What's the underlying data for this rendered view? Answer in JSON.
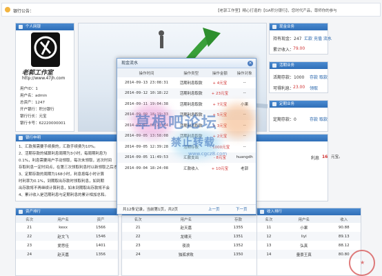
{
  "bank_notice": {
    "label": "银行公告：",
    "text": "【老郭工作室】精心打造的【GA积分银行】，您时代产品，尊师你的参与"
  },
  "personal": {
    "title": "个人网银",
    "logo_text": "老郭工作室",
    "logo_url": "http://www.47jh.com",
    "fields": [
      {
        "label": "用户ID：",
        "value": "1"
      },
      {
        "label": "用户名：",
        "value": "admin"
      },
      {
        "label": "总资产：",
        "value": "1247"
      },
      {
        "label": "开户银行：",
        "value": "积分银行"
      },
      {
        "label": "银行行长：",
        "value": "元宝"
      },
      {
        "label": "银行卡号：",
        "value": "62220000001"
      }
    ]
  },
  "cash": {
    "title": "现金业务",
    "holdings_label": "持有现金：247",
    "actions": [
      "汇款",
      "充值",
      "流水"
    ],
    "total_label": "累计收入：",
    "total_value": "79.00"
  },
  "demand": {
    "title": "活期业务",
    "deposit_label": "活期存款：1000",
    "deposit_actions": [
      "存款",
      "取款"
    ],
    "interest_label": "可得利息：",
    "interest_value": "23.00",
    "interest_action": "领取"
  },
  "fixed": {
    "title": "定期业务",
    "deposit_label": "定期存款：0",
    "deposit_actions": [
      "存款",
      "取款"
    ]
  },
  "rules": {
    "title": "银行申明",
    "lines": [
      "1、汇款虽需要手续费的，汇款手续费为10%。",
      "2、活期存款的储算利息周期为3小时，每周期利息为",
      "0.1%，利息需要用户手动领取，每次未领取，这次时间",
      "存取利息一定时间点，在第三次领取利息时以新领取之后才有利率计算，利率的变动效益不计算。",
      "3、定期存款的周期为168小时，利息按每小时计算",
      "时利率为0.1%，到期取出存款时领取利息，如到期",
      "出存款将不再继续计算利息，如未到期取出存款将不会",
      "4、累计收入是活期利息与定期利息的累计相加总和。"
    ],
    "interest_label": "利息",
    "interest_value": "16",
    "interest_unit": "元宝。"
  },
  "modal": {
    "title": "现金流水",
    "close_glyph": "×",
    "columns": [
      "操作时间",
      "操作类型",
      "操作金额",
      "操作对象"
    ],
    "rows": [
      {
        "time": "2014-09-13 23:08:31",
        "type": "活期利息取款",
        "amount": "+ 4元宝",
        "target": "--"
      },
      {
        "time": "2014-09-12 10:18:22",
        "type": "活期利息取款",
        "amount": "+ 23元宝",
        "target": "--"
      },
      {
        "time": "2014-09-11 19:04:38",
        "type": "活期利息取款",
        "amount": "+ 7元宝",
        "target": "小果"
      },
      {
        "time": "2014-09-09 18:19:33",
        "type": "活期利息取款",
        "amount": "+ 5元宝",
        "target": "--"
      },
      {
        "time": "2014-09-07 00:23:44",
        "type": "活期利息取款",
        "amount": "+ 3元宝",
        "target": "--"
      },
      {
        "time": "2014-09-05 13:58:08",
        "type": "活期利息取款",
        "amount": "+ 2元宝",
        "target": "--"
      },
      {
        "time": "2014-09-05 12:39:28",
        "type": "活期存款",
        "amount": "- 1000元宝",
        "target": "--"
      },
      {
        "time": "2014-09-05 11:49:53",
        "type": "汇款支出",
        "amount": "- 8元宝",
        "target": "huangdh"
      },
      {
        "time": "2014-09-04 18:24:08",
        "type": "汇款收入",
        "amount": "+ 10元宝",
        "target": "老郭"
      }
    ],
    "pager": {
      "summary": "共12条记录，当前第1页，共2页",
      "prev": "上一页",
      "next": "下一页"
    }
  },
  "rank_assets": {
    "title": "资产排行",
    "columns": [
      "名次",
      "用户名",
      "资产"
    ],
    "rows": [
      [
        "21",
        "kexx",
        "1566"
      ],
      [
        "22",
        "赵文飞",
        "1546"
      ],
      [
        "23",
        "爱思佳",
        "1401"
      ],
      [
        "24",
        "赵天嘉",
        "1356"
      ]
    ]
  },
  "rank_deposit": {
    "columns": [
      "名次",
      "用户名",
      "存款"
    ],
    "rows": [
      [
        "21",
        "赵天嘉",
        "1355"
      ],
      [
        "22",
        "龙啸天",
        "1351"
      ],
      [
        "23",
        "夜浪",
        "1352"
      ],
      [
        "24",
        "独孤求败",
        "1350"
      ]
    ]
  },
  "rank_income": {
    "title": "收入排行",
    "columns": [
      "名次",
      "用户名",
      "收入"
    ],
    "rows": [
      [
        "11",
        "小果",
        "90.88"
      ],
      [
        "12",
        "liyl",
        "89.13"
      ],
      [
        "13",
        "弘真",
        "88.12"
      ],
      [
        "14",
        "量景王真",
        "80.80"
      ]
    ]
  },
  "watermark": {
    "line1": "草根吧论坛",
    "line2": "禁止转载",
    "line3": "www.cgcz8.com"
  },
  "colors": {
    "header_blue": "#2f6fb8",
    "red_value": "#d03030",
    "link_blue": "#1f5fa8"
  }
}
